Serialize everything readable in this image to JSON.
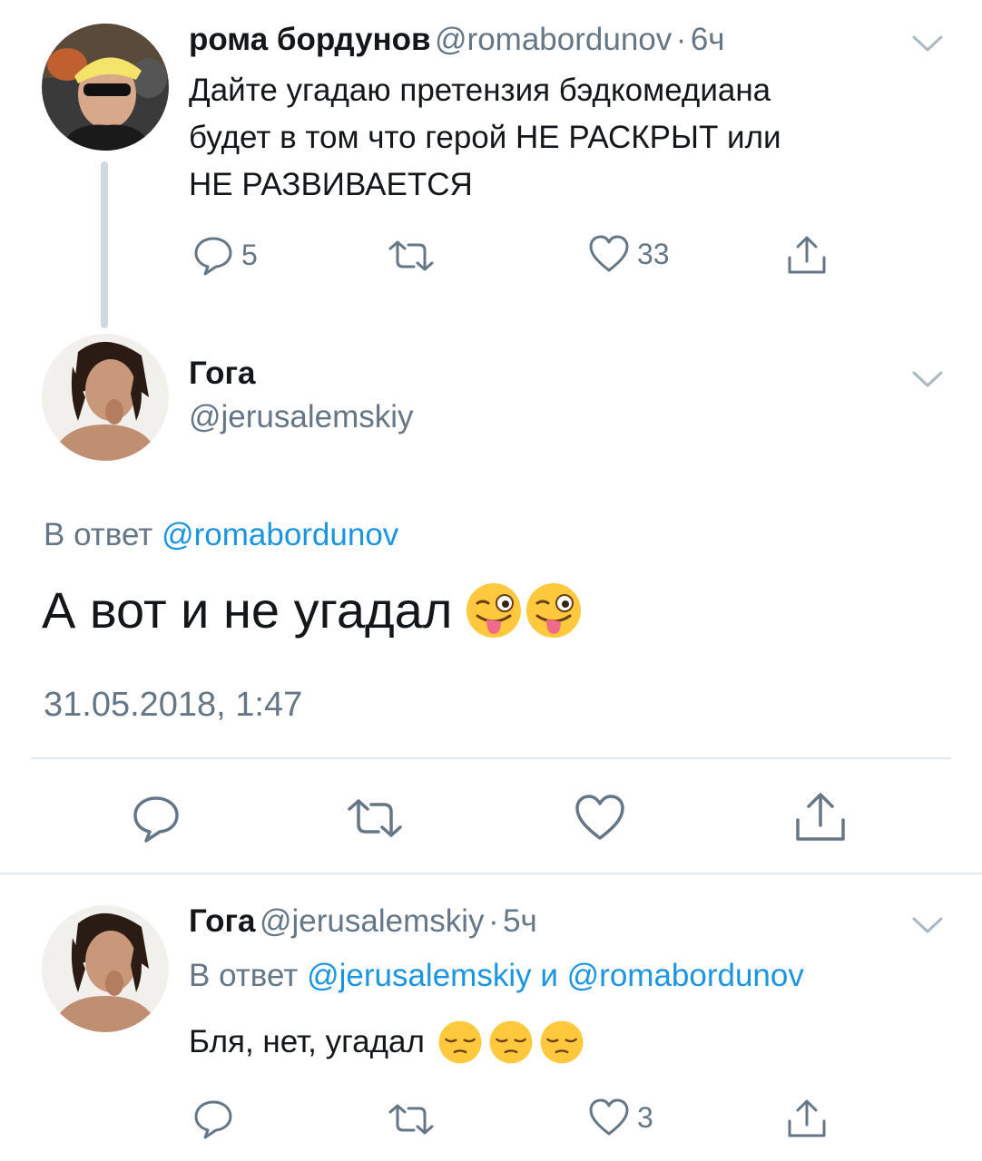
{
  "tweet1": {
    "name": "рома бордунов",
    "handle": "@romabordunov",
    "time": "6ч",
    "text_lines": [
      "Дайте угадаю претензия бэдкомедиана",
      "будет в том что герой НЕ РАСКРЫТ или",
      "НЕ РАЗВИВАЕТСЯ"
    ],
    "replies": "5",
    "retweets": "",
    "likes": "33"
  },
  "main_tweet": {
    "name": "Гога",
    "handle": "@jerusalemskiy",
    "reply_prefix": "В ответ",
    "reply_to": "@romabordunov",
    "text": "А вот и не угадал",
    "emoji": [
      "winking-face-with-tongue",
      "winking-face-with-tongue"
    ],
    "timestamp": "31.05.2018, 1:47"
  },
  "tweet3": {
    "name": "Гога",
    "handle": "@jerusalemskiy",
    "time": "5ч",
    "reply_prefix": "В ответ",
    "reply_to_1": "@jerusalemskiy",
    "reply_and": "и",
    "reply_to_2": "@romabordunov",
    "text": "Бля, нет, угадал",
    "emoji": [
      "pensive-face",
      "pensive-face",
      "pensive-face"
    ],
    "replies": "",
    "retweets": "",
    "likes": "3"
  },
  "colors": {
    "text": "#14171a",
    "secondary": "#657786",
    "link": "#1b95e0",
    "divider": "#e1e8ed"
  }
}
